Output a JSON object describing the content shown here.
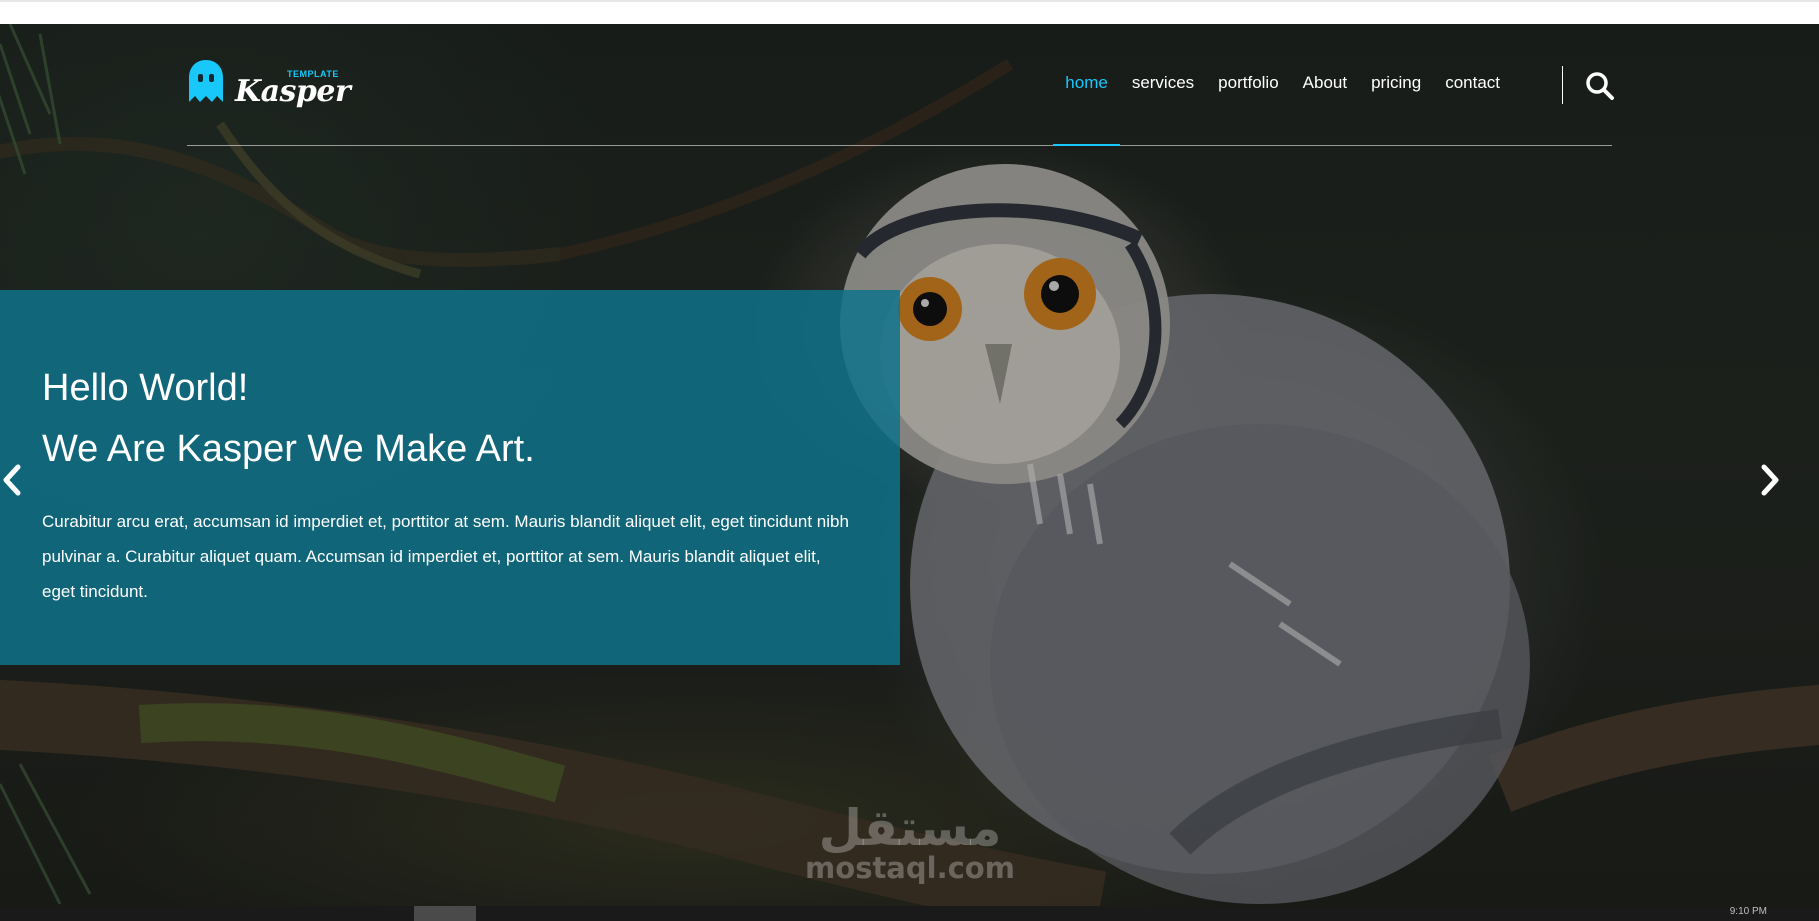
{
  "logo": {
    "tagline": "TEMPLATE",
    "name": "Kasper",
    "icon": "ghost-icon"
  },
  "nav": {
    "items": [
      {
        "label": "home",
        "active": true
      },
      {
        "label": "services",
        "active": false
      },
      {
        "label": "portfolio",
        "active": false
      },
      {
        "label": "About",
        "active": false
      },
      {
        "label": "pricing",
        "active": false
      },
      {
        "label": "contact",
        "active": false
      }
    ],
    "search_icon": "search-icon"
  },
  "hero": {
    "title_line1": "Hello World!",
    "title_line2": "We Are Kasper We Make Art.",
    "body": "Curabitur arcu erat, accumsan id imperdiet et, porttitor at sem. Mauris blandit aliquet elit, eget tincidunt nibh pulvinar a. Curabitur aliquet quam. Accumsan id imperdiet et, porttitor at sem. Mauris blandit aliquet elit, eget tincidunt.",
    "prev_icon": "chevron-left-icon",
    "next_icon": "chevron-right-icon"
  },
  "watermark": {
    "arabic": "مستقل",
    "latin": "mostaql.com"
  },
  "taskbar": {
    "clock": "9:10 PM"
  },
  "colors": {
    "accent": "#19c8fa",
    "content_box": "#0f728a",
    "text": "#ffffff"
  }
}
